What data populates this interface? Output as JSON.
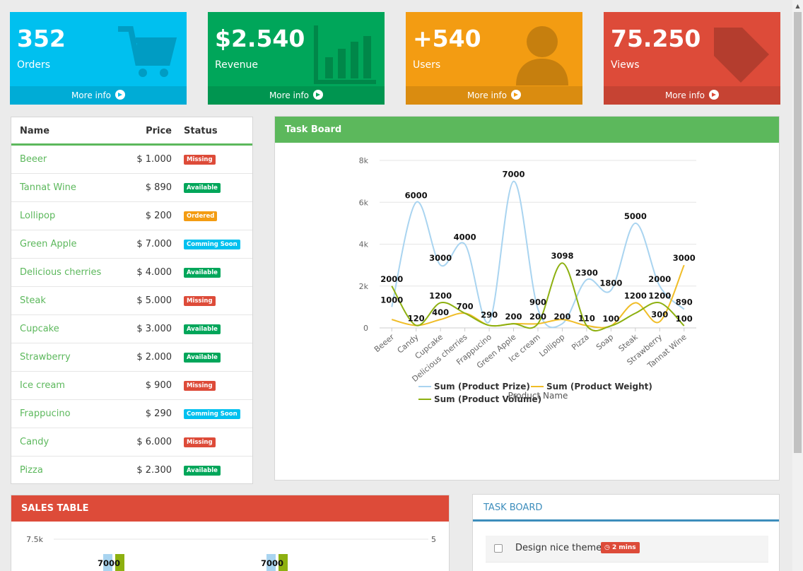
{
  "tiles": [
    {
      "value": "352",
      "label": "Orders",
      "more": "More info",
      "color": "#00c0ef",
      "icon": "cart-icon"
    },
    {
      "value": "$2.540",
      "label": "Revenue",
      "more": "More info",
      "color": "#00a65a",
      "icon": "bar-chart-icon"
    },
    {
      "value": "+540",
      "label": "Users",
      "more": "More info",
      "color": "#f39c12",
      "icon": "user-icon"
    },
    {
      "value": "75.250",
      "label": "Views",
      "more": "More info",
      "color": "#dd4b39",
      "icon": "tag-icon"
    }
  ],
  "products": {
    "headers": {
      "name": "Name",
      "price": "Price",
      "status": "Status"
    },
    "rows": [
      {
        "name": "Beeer",
        "price": "$ 1.000",
        "status": "Missing",
        "color": "#dd4b39"
      },
      {
        "name": "Tannat Wine",
        "price": "$ 890",
        "status": "Available",
        "color": "#00a65a"
      },
      {
        "name": "Lollipop",
        "price": "$ 200",
        "status": "Ordered",
        "color": "#f39c12"
      },
      {
        "name": "Green Apple",
        "price": "$ 7.000",
        "status": "Comming Soon",
        "color": "#00c0ef"
      },
      {
        "name": "Delicious cherries",
        "price": "$ 4.000",
        "status": "Available",
        "color": "#00a65a"
      },
      {
        "name": "Steak",
        "price": "$ 5.000",
        "status": "Missing",
        "color": "#dd4b39"
      },
      {
        "name": "Cupcake",
        "price": "$ 3.000",
        "status": "Available",
        "color": "#00a65a"
      },
      {
        "name": "Strawberry",
        "price": "$ 2.000",
        "status": "Available",
        "color": "#00a65a"
      },
      {
        "name": "Ice cream",
        "price": "$ 900",
        "status": "Missing",
        "color": "#dd4b39"
      },
      {
        "name": "Frappucino",
        "price": "$ 290",
        "status": "Comming Soon",
        "color": "#00c0ef"
      },
      {
        "name": "Candy",
        "price": "$ 6.000",
        "status": "Missing",
        "color": "#dd4b39"
      },
      {
        "name": "Pizza",
        "price": "$ 2.300",
        "status": "Available",
        "color": "#00a65a"
      }
    ]
  },
  "chart_panel": {
    "title": "Task Board"
  },
  "chart_data": {
    "type": "line",
    "categories": [
      "Beeer",
      "Candy",
      "Cupcake",
      "Delicious cherries",
      "Frappucino",
      "Green Apple",
      "Ice cream",
      "Lollipop",
      "Pizza",
      "Soap",
      "Steak",
      "Strawberry",
      "Tannat Wine"
    ],
    "series": [
      {
        "name": "Sum (Product Prize)",
        "color": "#a9d4f0",
        "values": [
          1000,
          6000,
          3000,
          4000,
          290,
          7000,
          900,
          200,
          2300,
          1800,
          5000,
          2000,
          890
        ]
      },
      {
        "name": "Sum (Product Weight)",
        "color": "#f0bd27",
        "values": [
          400,
          120,
          400,
          700,
          120,
          200,
          200,
          400,
          110,
          100,
          1200,
          300,
          3000
        ]
      },
      {
        "name": "Sum (Product Volume)",
        "color": "#8db010",
        "values": [
          2000,
          120,
          1200,
          700,
          120,
          200,
          200,
          3098,
          110,
          100,
          700,
          1200,
          100
        ]
      }
    ],
    "value_labels": [
      {
        "text": "2000",
        "cat": 0,
        "y": 2000
      },
      {
        "text": "1000",
        "cat": 0,
        "y": 1000
      },
      {
        "text": "6000",
        "cat": 1,
        "y": 6000
      },
      {
        "text": "120",
        "cat": 1,
        "y": 120
      },
      {
        "text": "3000",
        "cat": 2,
        "y": 3000
      },
      {
        "text": "1200",
        "cat": 2,
        "y": 1200
      },
      {
        "text": "400",
        "cat": 2,
        "y": 400
      },
      {
        "text": "4000",
        "cat": 3,
        "y": 4000
      },
      {
        "text": "700",
        "cat": 3,
        "y": 700
      },
      {
        "text": "290",
        "cat": 4,
        "y": 290
      },
      {
        "text": "7000",
        "cat": 5,
        "y": 7000
      },
      {
        "text": "200",
        "cat": 5,
        "y": 200
      },
      {
        "text": "900",
        "cat": 6,
        "y": 900
      },
      {
        "text": "200",
        "cat": 6,
        "y": 200
      },
      {
        "text": "3098",
        "cat": 7,
        "y": 3098
      },
      {
        "text": "200",
        "cat": 7,
        "y": 200
      },
      {
        "text": "2300",
        "cat": 8,
        "y": 2300
      },
      {
        "text": "110",
        "cat": 8,
        "y": 110
      },
      {
        "text": "1800",
        "cat": 9,
        "y": 1800
      },
      {
        "text": "100",
        "cat": 9,
        "y": 100
      },
      {
        "text": "5000",
        "cat": 10,
        "y": 5000
      },
      {
        "text": "1200",
        "cat": 10,
        "y": 1200
      },
      {
        "text": "2000",
        "cat": 11,
        "y": 2000
      },
      {
        "text": "1200",
        "cat": 11,
        "y": 1200
      },
      {
        "text": "300",
        "cat": 11,
        "y": 300
      },
      {
        "text": "3000",
        "cat": 12,
        "y": 3000
      },
      {
        "text": "890",
        "cat": 12,
        "y": 890
      },
      {
        "text": "100",
        "cat": 12,
        "y": 100
      }
    ],
    "yticks": [
      {
        "v": 0,
        "t": "0"
      },
      {
        "v": 2000,
        "t": "2k"
      },
      {
        "v": 4000,
        "t": "4k"
      },
      {
        "v": 6000,
        "t": "6k"
      },
      {
        "v": 8000,
        "t": "8k"
      }
    ],
    "ylim": [
      0,
      8000
    ],
    "xlabel": "Product Name",
    "ylabel": "",
    "legend": "bottom"
  },
  "sales": {
    "title": "SALES TABLE",
    "left_axis_top": "7.5k",
    "right_axis_top": "5",
    "bar_labels": [
      "7000",
      "7000"
    ]
  },
  "tasks": {
    "title": "TASK BOARD",
    "items": [
      {
        "text": "Design nice themes",
        "badge": "2 mins",
        "badge_color": "#dd4b39"
      }
    ]
  }
}
